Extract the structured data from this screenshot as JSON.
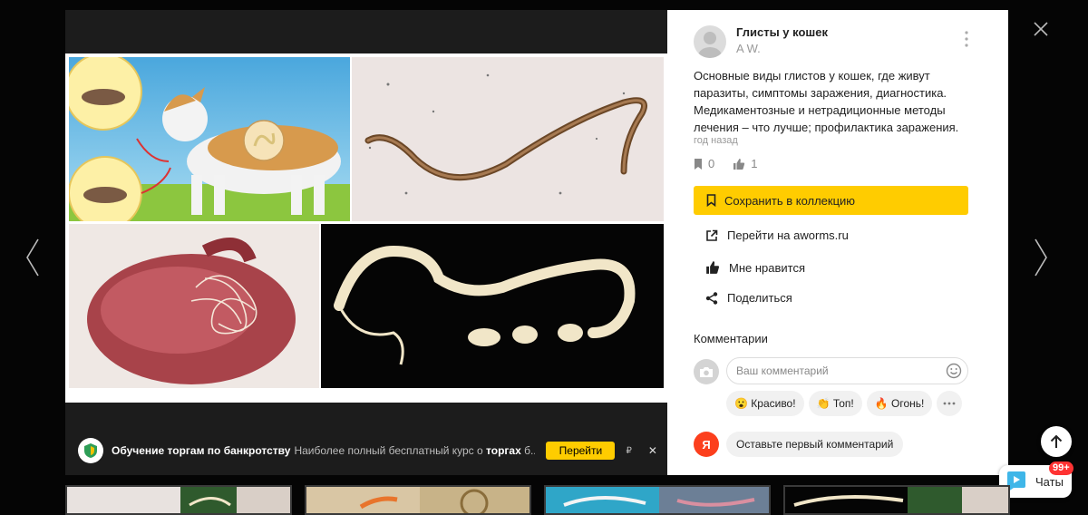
{
  "pin": {
    "board_title": "Глисты у кошек",
    "author": "A W.",
    "description": "Основные виды глистов у кошек, где живут паразиты, симптомы заражения, диагностика. Медикаментозные и нетрадиционные методы лечения – что лучше; профилактика заражения.",
    "time": "год назад",
    "saves_count": "0",
    "likes_count": "1"
  },
  "actions": {
    "save_label": "Сохранить в коллекцию",
    "visit_label": "Перейти на aworms.ru",
    "like_label": "Мне нравится",
    "share_label": "Поделиться"
  },
  "comments": {
    "title": "Комментарии",
    "placeholder": "Ваш комментарий",
    "chips": [
      "😮 Красиво!",
      "👏 Топ!",
      "🔥 Огонь!"
    ],
    "ya_letter": "Я",
    "first_comment": "Оставьте первый комментарий"
  },
  "ad": {
    "title": "Обучение торгам по банкротству",
    "text_before": "Наиболее полный бесплатный курс о ",
    "text_bold": "торгах",
    "text_after": " б...",
    "button": "Перейти",
    "currency": "₽",
    "close": "✕"
  },
  "widgets": {
    "chats_label": "Чаты",
    "chats_badge": "99+"
  },
  "colors": {
    "accent": "#ffcc00",
    "yandex_red": "#fc3f1d",
    "badge_red": "#ff3333"
  },
  "icons": {
    "close": "close-icon",
    "prev": "chevron-left-icon",
    "next": "chevron-right-icon",
    "more": "more-vertical-icon",
    "bookmark": "bookmark-icon",
    "like": "thumb-up-icon",
    "external": "external-link-icon",
    "share": "share-icon",
    "camera": "camera-icon",
    "smiley": "smiley-icon",
    "scroll_top": "arrow-up-icon",
    "chats": "chat-icon"
  }
}
